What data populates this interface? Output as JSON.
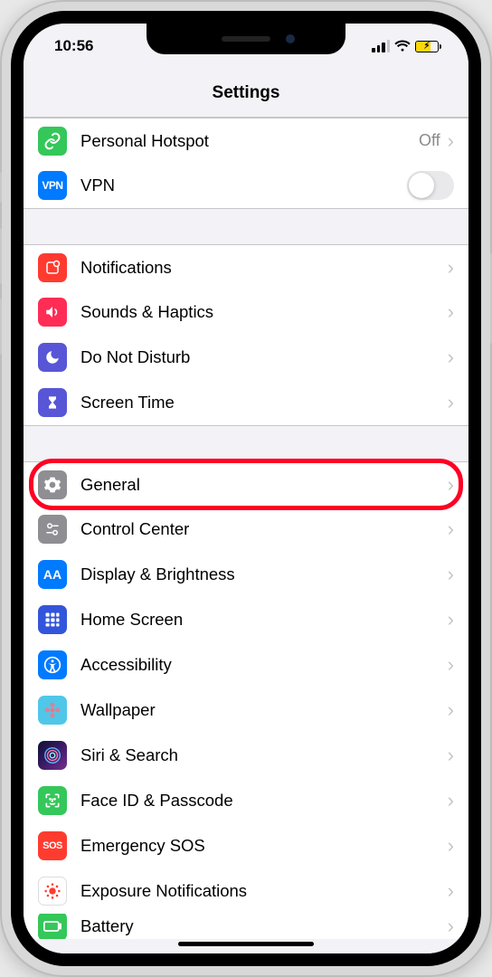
{
  "status": {
    "time": "10:56"
  },
  "header": {
    "title": "Settings"
  },
  "group1": [
    {
      "key": "hotspot",
      "label": "Personal Hotspot",
      "detail": "Off",
      "icon_bg": "#34c759",
      "icon_name": "link-icon",
      "chevron": true
    },
    {
      "key": "vpn",
      "label": "VPN",
      "icon_bg": "#007aff",
      "icon_text": "VPN",
      "icon_name": "vpn-icon",
      "toggle": true
    }
  ],
  "group2": [
    {
      "key": "notifications",
      "label": "Notifications",
      "icon_bg": "#ff3b30",
      "icon_name": "notifications-icon"
    },
    {
      "key": "sounds",
      "label": "Sounds & Haptics",
      "icon_bg": "#ff2d55",
      "icon_name": "speaker-icon"
    },
    {
      "key": "dnd",
      "label": "Do Not Disturb",
      "icon_bg": "#5856d6",
      "icon_name": "moon-icon"
    },
    {
      "key": "screentime",
      "label": "Screen Time",
      "icon_bg": "#5856d6",
      "icon_name": "hourglass-icon"
    }
  ],
  "group3": [
    {
      "key": "general",
      "label": "General",
      "icon_bg": "#8e8e93",
      "icon_name": "gear-icon",
      "highlight": true
    },
    {
      "key": "controlcenter",
      "label": "Control Center",
      "icon_bg": "#8e8e93",
      "icon_name": "switches-icon"
    },
    {
      "key": "display",
      "label": "Display & Brightness",
      "icon_bg": "#007aff",
      "icon_text": "AA",
      "icon_name": "text-size-icon"
    },
    {
      "key": "homescreen",
      "label": "Home Screen",
      "icon_bg": "#3355dc",
      "icon_name": "grid-icon"
    },
    {
      "key": "accessibility",
      "label": "Accessibility",
      "icon_bg": "#007aff",
      "icon_name": "accessibility-icon"
    },
    {
      "key": "wallpaper",
      "label": "Wallpaper",
      "icon_bg": "#50c7e8",
      "icon_name": "flower-icon"
    },
    {
      "key": "siri",
      "label": "Siri & Search",
      "icon_bg": "linear-gradient(135deg,#2a1e5c,#8a2be2)",
      "icon_name": "siri-icon"
    },
    {
      "key": "faceid",
      "label": "Face ID & Passcode",
      "icon_bg": "#34c759",
      "icon_name": "faceid-icon"
    },
    {
      "key": "sos",
      "label": "Emergency SOS",
      "icon_bg": "#ff3b30",
      "icon_text": "SOS",
      "icon_name": "sos-icon"
    },
    {
      "key": "exposure",
      "label": "Exposure Notifications",
      "icon_bg": "#ffffff",
      "icon_name": "exposure-icon",
      "icon_border": true
    },
    {
      "key": "battery",
      "label": "Battery",
      "icon_bg": "#34c759",
      "icon_name": "battery-icon"
    }
  ]
}
